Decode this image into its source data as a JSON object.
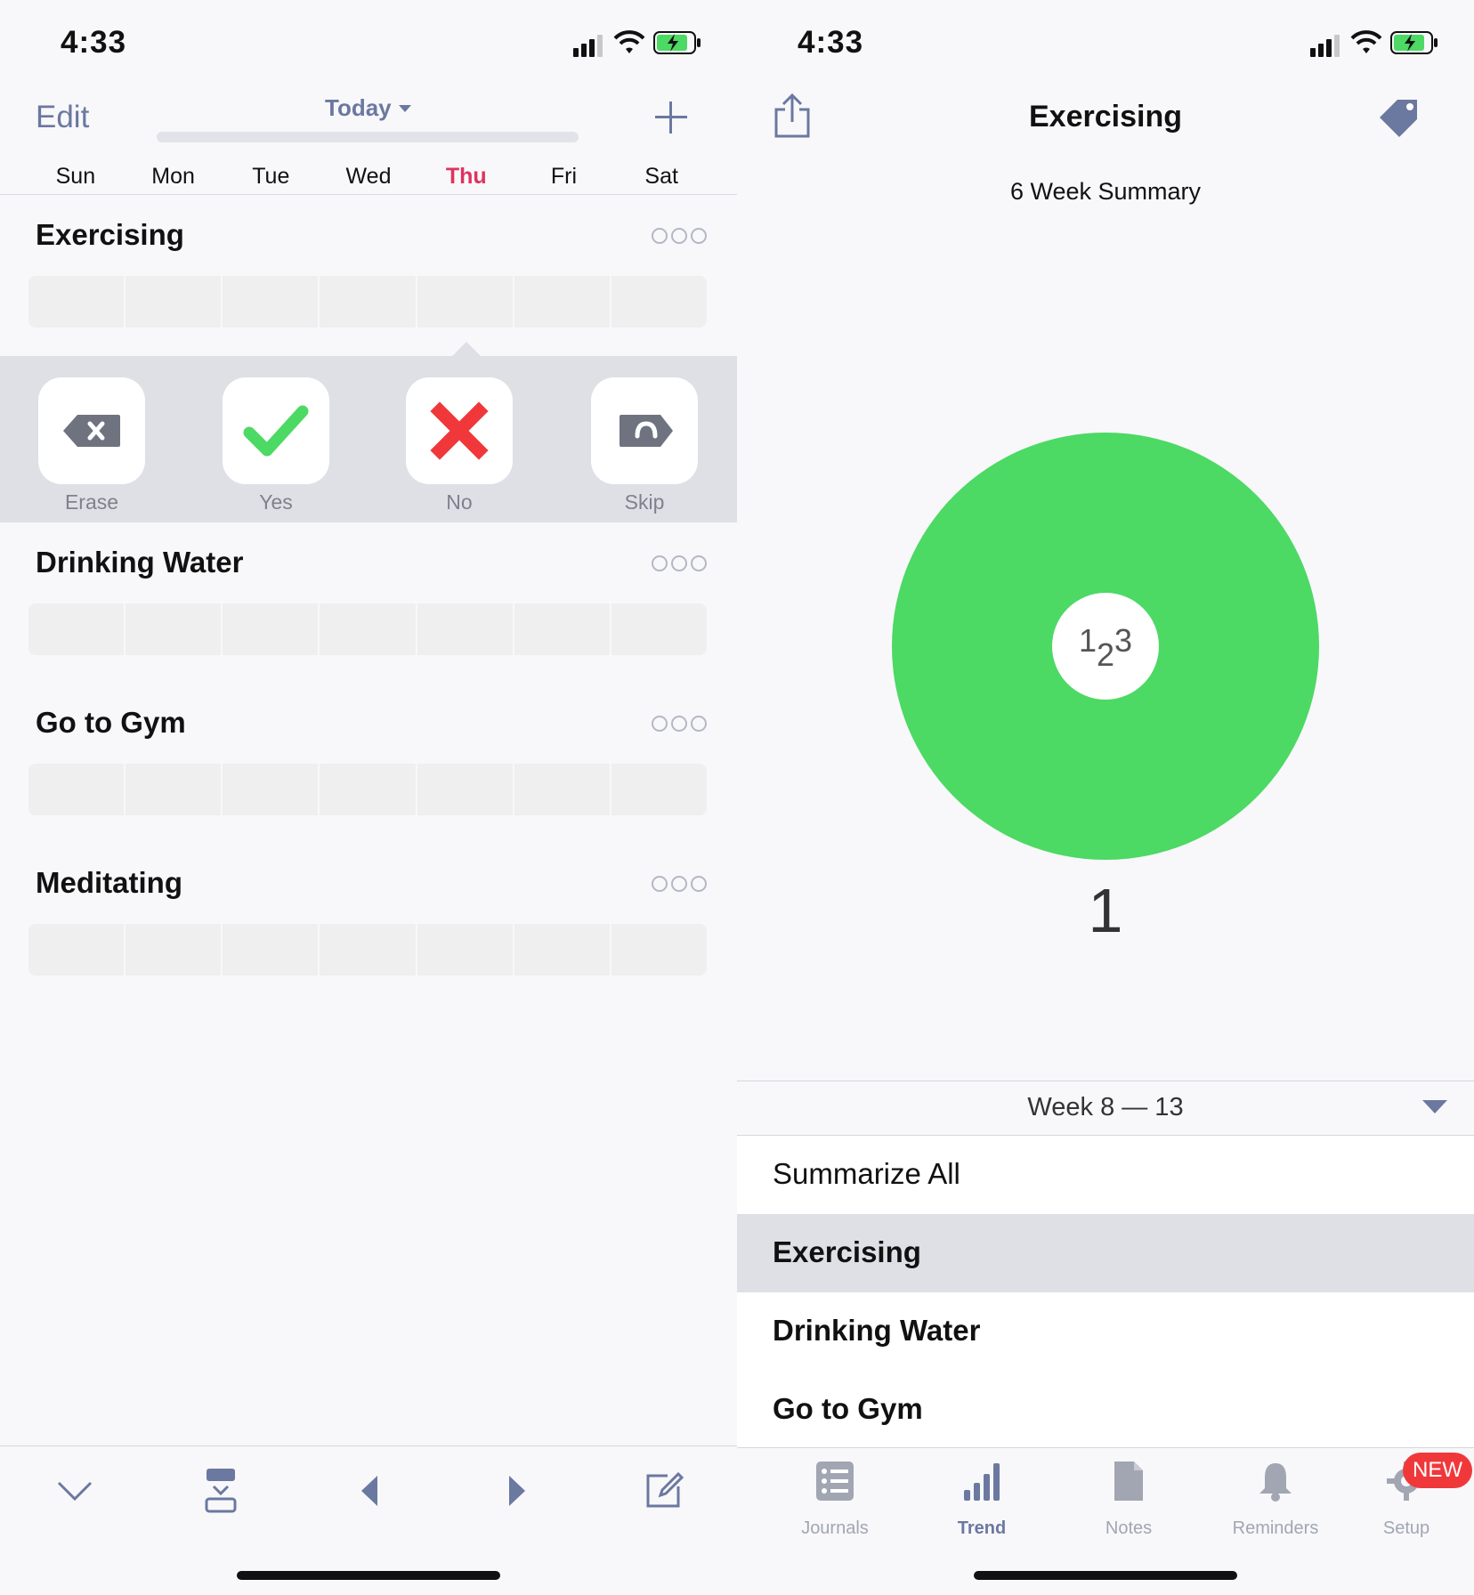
{
  "left": {
    "status_time": "4:33",
    "nav": {
      "edit": "Edit",
      "today": "Today"
    },
    "weekdays": [
      "Sun",
      "Mon",
      "Tue",
      "Wed",
      "Thu",
      "Fri",
      "Sat"
    ],
    "habits": [
      {
        "title": "Exercising"
      },
      {
        "title": "Drinking Water"
      },
      {
        "title": "Go to Gym"
      },
      {
        "title": "Meditating"
      }
    ],
    "picker": {
      "erase": "Erase",
      "yes": "Yes",
      "no": "No",
      "skip": "Skip"
    },
    "colors": {
      "accent": "#6b78a0",
      "today": "#e0325f",
      "yes": "#4cd964",
      "no": "#f0383b"
    }
  },
  "right": {
    "status_time": "4:33",
    "title": "Exercising",
    "summary_title": "6 Week Summary",
    "count_label": "1",
    "week_range": "Week 8 — 13",
    "list": [
      "Summarize All",
      "Exercising",
      "Drinking Water",
      "Go to Gym"
    ],
    "tabs": [
      "Journals",
      "Trend",
      "Notes",
      "Reminders",
      "Setup"
    ],
    "badge": "NEW",
    "center_icon_text": "123"
  },
  "chart_data": {
    "type": "pie",
    "categories": [
      "Yes"
    ],
    "values": [
      1
    ],
    "colors": [
      "#4cd964"
    ],
    "title": "6 Week Summary"
  }
}
